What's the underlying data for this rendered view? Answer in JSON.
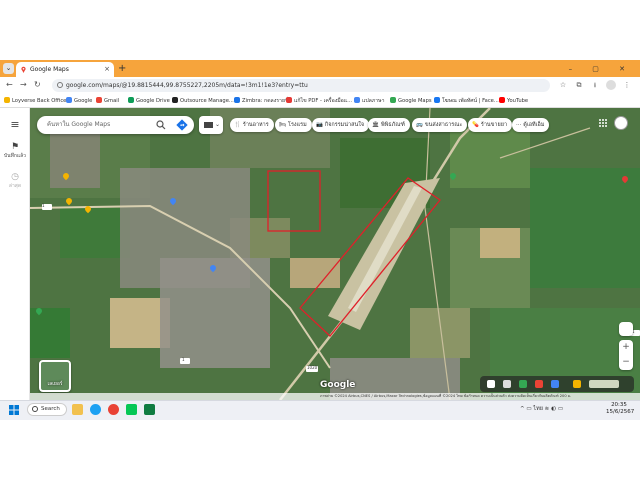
{
  "browser": {
    "tab_title": "Google Maps",
    "new_tab": "+",
    "window_controls": "–  ▢  ✕",
    "url": "google.com/maps/@19.8815444,99.8755227,2205m/data=!3m1!1e3?entry=ttu",
    "bookmarks": [
      {
        "label": "Loyverse Back Office",
        "color": "#f4b400"
      },
      {
        "label": "Google",
        "color": "#4285f4"
      },
      {
        "label": "Gmail",
        "color": "#ea4335"
      },
      {
        "label": "Google Drive",
        "color": "#0f9d58"
      },
      {
        "label": "Outsource Manage...",
        "color": "#222222"
      },
      {
        "label": "Zimbra: กดลงรายชื่",
        "color": "#1a73e8"
      },
      {
        "label": "แก้ไข PDF - เครื่องมือแ...",
        "color": "#e53935"
      },
      {
        "label": "แปลภาษา",
        "color": "#4285f4"
      },
      {
        "label": "Google Maps",
        "color": "#34a853"
      },
      {
        "label": "โฆษณ เพ้อทัศน์ | Face...",
        "color": "#1877f2"
      },
      {
        "label": "YouTube",
        "color": "#ff0000"
      }
    ]
  },
  "rail": {
    "menu_icon": "≡",
    "saved_label": "บันทึกแล้ว",
    "recent_label": "ล่าสุด"
  },
  "search": {
    "placeholder": "ค้นหาใน Google Maps"
  },
  "chips": [
    {
      "icon": "🍴",
      "label": "ร้านอาหาร"
    },
    {
      "icon": "🛏",
      "label": "โรงแรม"
    },
    {
      "icon": "📷",
      "label": "กิจกรรมน่าสนใจ"
    },
    {
      "icon": "🏛",
      "label": "พิพิธภัณฑ์"
    },
    {
      "icon": "🚌",
      "label": "ขนส่งสาธารณะ"
    },
    {
      "icon": "💊",
      "label": "ร้านขายยา"
    },
    {
      "icon": "···",
      "label": "ตู้เอทีเอ็ม"
    }
  ],
  "map": {
    "layers_label": "เลเยอร์",
    "logo": "Google",
    "attribution": "ภาพถ่าย ©2024 Airbus,CNES / Airbus,Maxar Technologies,ข้อมูลแผนที่ ©2024    ไทย   ข้อกำหนด   ความเป็นส่วนตัว   ส่งความคิดเห็นเกี่ยวกับผลิตภัณฑ์   200 ม.",
    "road_labels": [
      "1",
      "1",
      "1020",
      "1"
    ]
  },
  "taskbar": {
    "search_label": "Search",
    "tray_text": "^  ▭  ไทย  ≋  ◖) ▭",
    "time": "20:35",
    "date": "15/6/2567"
  }
}
